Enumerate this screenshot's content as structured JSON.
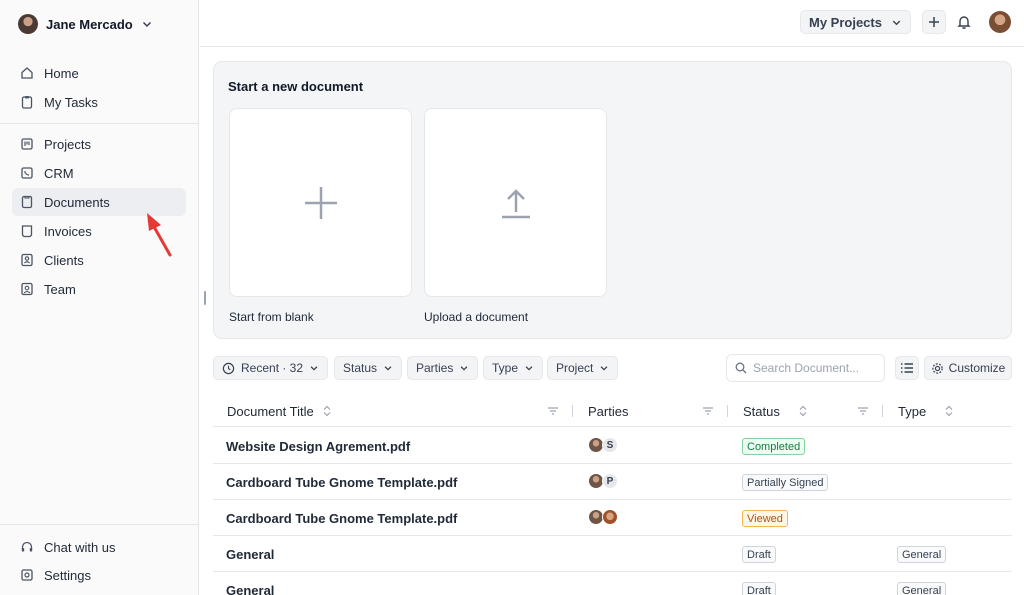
{
  "user": {
    "name": "Jane Mercado"
  },
  "sidebar": {
    "top_items": [
      {
        "label": "Home",
        "icon": "home-icon"
      },
      {
        "label": "My Tasks",
        "icon": "clipboard-icon"
      }
    ],
    "main_items": [
      {
        "label": "Projects",
        "icon": "kanban-icon"
      },
      {
        "label": "CRM",
        "icon": "phone-book-icon"
      },
      {
        "label": "Documents",
        "icon": "document-icon",
        "active": true
      },
      {
        "label": "Invoices",
        "icon": "invoice-icon"
      },
      {
        "label": "Clients",
        "icon": "contact-icon"
      },
      {
        "label": "Team",
        "icon": "team-icon"
      }
    ],
    "bottom_items": [
      {
        "label": "Chat with us",
        "icon": "headset-icon"
      },
      {
        "label": "Settings",
        "icon": "settings-icon"
      }
    ]
  },
  "header": {
    "project_selector": "My Projects"
  },
  "start_panel": {
    "title": "Start a new document",
    "cards": [
      {
        "label": "Start from blank",
        "icon": "plus-icon"
      },
      {
        "label": "Upload a document",
        "icon": "upload-icon"
      }
    ]
  },
  "filters": {
    "recent": "Recent · 32",
    "status": "Status",
    "parties": "Parties",
    "type": "Type",
    "project": "Project",
    "search_placeholder": "Search Document...",
    "customize": "Customize"
  },
  "table": {
    "columns": [
      "Document Title",
      "Parties",
      "Status",
      "Type"
    ],
    "rows": [
      {
        "title": "Website Design Agrement.pdf",
        "parties": "S",
        "status": "Completed",
        "status_kind": "completed",
        "type": ""
      },
      {
        "title": "Cardboard Tube Gnome Template.pdf",
        "parties": "P",
        "status": "Partially Signed",
        "status_kind": "neutral",
        "type": ""
      },
      {
        "title": "Cardboard Tube Gnome Template.pdf",
        "parties": "",
        "status": "Viewed",
        "status_kind": "viewed",
        "type": ""
      },
      {
        "title": "General",
        "parties": "",
        "status": "Draft",
        "status_kind": "neutral",
        "type": "General"
      },
      {
        "title": "General",
        "parties": "",
        "status": "Draft",
        "status_kind": "neutral",
        "type": "General"
      }
    ]
  },
  "colors": {
    "accent_arrow": "#e53935",
    "completed": "#15803d",
    "viewed": "#b45309"
  }
}
